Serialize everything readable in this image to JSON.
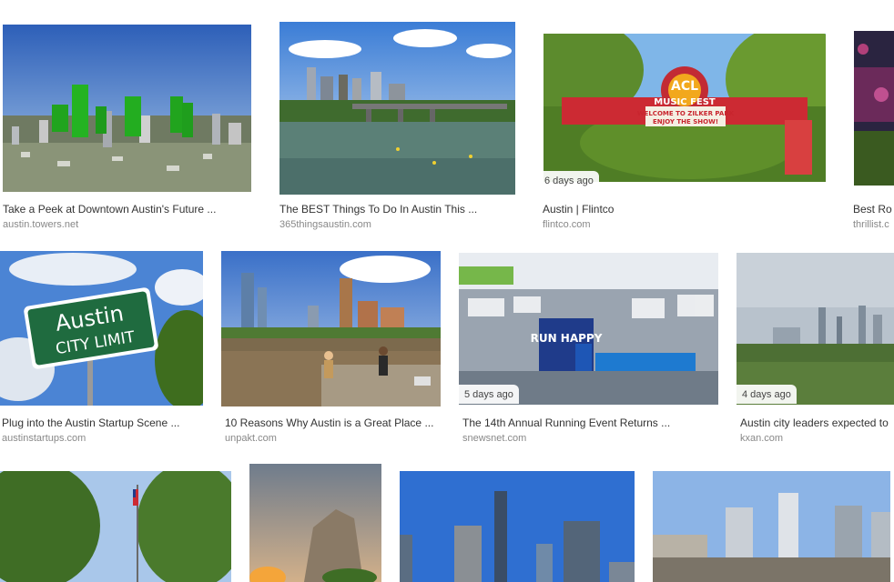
{
  "results": [
    {
      "title": "Take a Peek at Downtown Austin's Future ...",
      "source": "austin.towers.net",
      "badge": ""
    },
    {
      "title": "The BEST Things To Do In Austin This ...",
      "source": "365thingsaustin.com",
      "badge": ""
    },
    {
      "title": "Austin | Flintco",
      "source": "flintco.com",
      "badge": "6 days ago"
    },
    {
      "title": "Best Ro",
      "source": "thrillist.c",
      "badge": ""
    },
    {
      "title": "Plug into the Austin Startup Scene ...",
      "source": "austinstartups.com",
      "badge": ""
    },
    {
      "title": "10 Reasons Why Austin is a Great Place ...",
      "source": "unpakt.com",
      "badge": ""
    },
    {
      "title": "The 14th Annual Running Event Returns ...",
      "source": "snewsnet.com",
      "badge": "5 days ago"
    },
    {
      "title": "Austin city leaders expected to",
      "source": "kxan.com",
      "badge": "4 days ago"
    }
  ],
  "image_text": {
    "city_sign_line1": "Austin",
    "city_sign_line2": "CITY LIMIT",
    "acl_line1": "ACL",
    "acl_line2": "MUSIC FEST",
    "acl_line3": "WELCOME TO ZILKER PARK",
    "acl_line4": "ENJOY THE SHOW!",
    "expo_banner": "RUN HAPPY"
  }
}
